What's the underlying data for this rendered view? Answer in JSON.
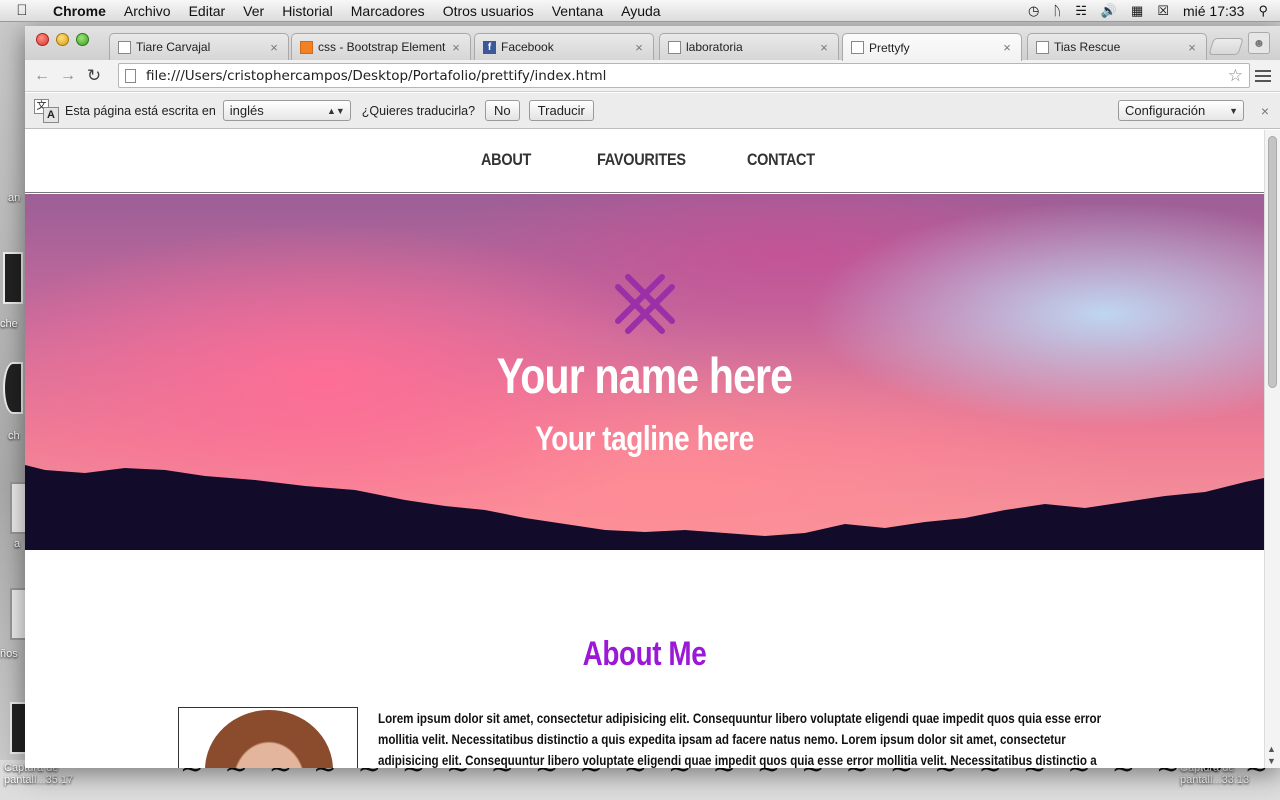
{
  "menubar": {
    "app": "Chrome",
    "items": [
      "Archivo",
      "Editar",
      "Ver",
      "Historial",
      "Marcadores",
      "Otros usuarios",
      "Ventana",
      "Ayuda"
    ],
    "clock": "mié 17:33"
  },
  "desktop": {
    "labels": [
      "an",
      "che",
      "ch",
      "a",
      "ños"
    ],
    "bottom_left_label": "Captura de pantall...35.17",
    "bottom_right_label": "Captura de pantall...33.13"
  },
  "browser": {
    "tabs": [
      {
        "title": "Tiare Carvajal",
        "icon": "page-icon",
        "active": false
      },
      {
        "title": "css - Bootstrap Element",
        "icon": "stackoverflow-icon",
        "active": false
      },
      {
        "title": "Facebook",
        "icon": "facebook-icon",
        "active": false
      },
      {
        "title": "laboratoria",
        "icon": "page-icon",
        "active": false
      },
      {
        "title": "Prettyfy",
        "icon": "page-icon",
        "active": true
      },
      {
        "title": "Tias Rescue",
        "icon": "page-icon",
        "active": false
      }
    ],
    "url": "file:///Users/cristophercampos/Desktop/Portafolio/prettify/index.html"
  },
  "translate_bar": {
    "prefix": "Esta página está escrita en",
    "language": "inglés",
    "question": "¿Quieres traducirla?",
    "no_label": "No",
    "translate_label": "Traducir",
    "settings_label": "Configuración"
  },
  "site": {
    "nav": [
      "ABOUT",
      "FAVOURITES",
      "CONTACT"
    ],
    "hero": {
      "name": "Your name here",
      "tagline": "Your tagline here"
    },
    "about": {
      "title": "About Me",
      "text": "Lorem ipsum dolor sit amet, consectetur adipisicing elit. Consequuntur libero voluptate eligendi quae impedit quos quia esse error mollitia velit. Necessitatibus distinctio a quis expedita ipsam ad facere natus nemo. Lorem ipsum dolor sit amet, consectetur adipisicing elit. Consequuntur libero voluptate eligendi quae impedit quos quia esse error mollitia velit. Necessitatibus distinctio a"
    }
  },
  "colors": {
    "accent_purple": "#9b19d6",
    "mark_purple": "#9b2fa8"
  }
}
